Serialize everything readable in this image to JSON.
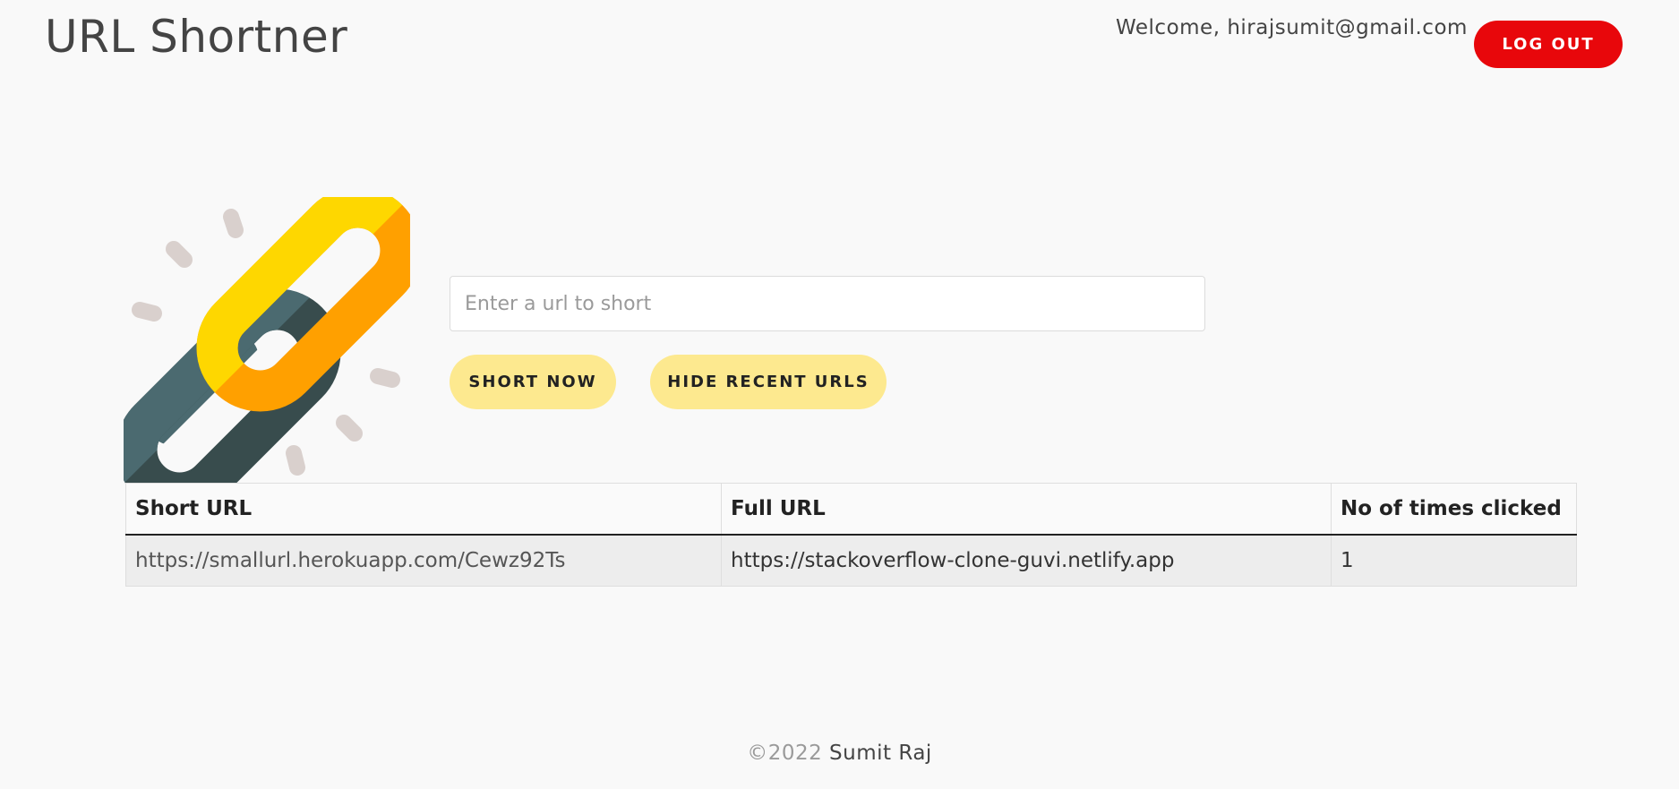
{
  "header": {
    "title": "URL Shortner",
    "welcome_text": "Welcome, hirajsumit@gmail.com",
    "logout_label": "LOG OUT"
  },
  "form": {
    "url_placeholder": "Enter a url to short",
    "url_value": "",
    "short_button_label": "SHORT NOW",
    "hide_button_label": "HIDE RECENT URLS"
  },
  "table": {
    "headers": [
      "Short URL",
      "Full URL",
      "No of times clicked"
    ],
    "rows": [
      {
        "short_url": "https://smallurl.herokuapp.com/Cewz92Ts",
        "full_url": "https://stackoverflow-clone-guvi.netlify.app",
        "clicks": "1"
      }
    ]
  },
  "footer": {
    "copyright": "©2022",
    "author": "Sumit Raj"
  },
  "icons": {
    "logo": "chain-link-icon"
  },
  "colors": {
    "background": "#f9f9f9",
    "logout_button": "#e8070b",
    "pill_button": "#fde98f",
    "link_yellow": "#fed700",
    "link_orange": "#ffa000",
    "link_slate": "#4b6a70",
    "link_dark": "#384c4d",
    "spark": "#d9d0cd"
  }
}
